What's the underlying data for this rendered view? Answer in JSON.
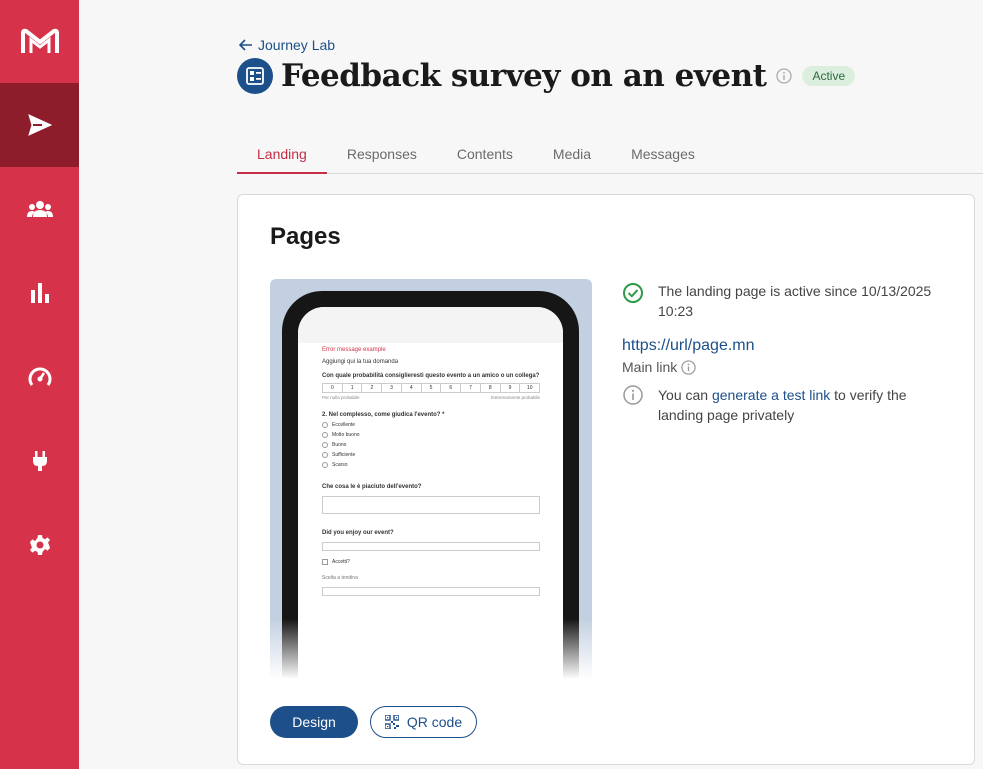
{
  "sidebar": {
    "items": [
      {
        "icon": "logo-icon"
      },
      {
        "icon": "send-icon",
        "active": true
      },
      {
        "icon": "people-icon"
      },
      {
        "icon": "bar-chart-icon"
      },
      {
        "icon": "speedometer-icon"
      },
      {
        "icon": "plug-icon"
      },
      {
        "icon": "gear-icon"
      }
    ]
  },
  "header": {
    "back_label": "Journey Lab",
    "title": "Feedback survey on an event",
    "status": "Active"
  },
  "tabs": [
    {
      "label": "Landing",
      "active": true
    },
    {
      "label": "Responses"
    },
    {
      "label": "Contents"
    },
    {
      "label": "Media"
    },
    {
      "label": "Messages"
    }
  ],
  "card": {
    "title": "Pages",
    "status_text": "The landing page is active since 10/13/2025 10:23",
    "url": "https://url/page.mn",
    "main_link_label": "Main link",
    "test_prefix": "You can ",
    "test_link": "generate a test link",
    "test_suffix": " to verify the landing page privately",
    "design_button": "Design",
    "qr_button": "QR code"
  },
  "preview": {
    "error_message": "Error message example",
    "intro": "Aggiungi qui la tua domanda",
    "q1": "Con quale probabilità consiglieresti questo evento a un amico o un collega?",
    "scale": [
      "0",
      "1",
      "2",
      "3",
      "4",
      "5",
      "6",
      "7",
      "8",
      "9",
      "10"
    ],
    "scale_low": "Per nulla probabile",
    "scale_high": "Estremamente probabile",
    "q2": "2. Nel complesso, come giudica l'evento? *",
    "options": [
      "Eccellente",
      "Molto buono",
      "Buono",
      "Sufficiente",
      "Scarso"
    ],
    "q3": "Che cosa le è piaciuto dell'evento?",
    "q4": "Did you enjoy our event?",
    "checkbox": "Accetti?",
    "dropdown": "Scelta a tendina"
  },
  "colors": {
    "sidebar": "#d6334a",
    "sidebar_active": "#8e1d2c",
    "primary": "#1d4f8a",
    "tab_active": "#c42f45",
    "success": "#2e9b4a"
  }
}
